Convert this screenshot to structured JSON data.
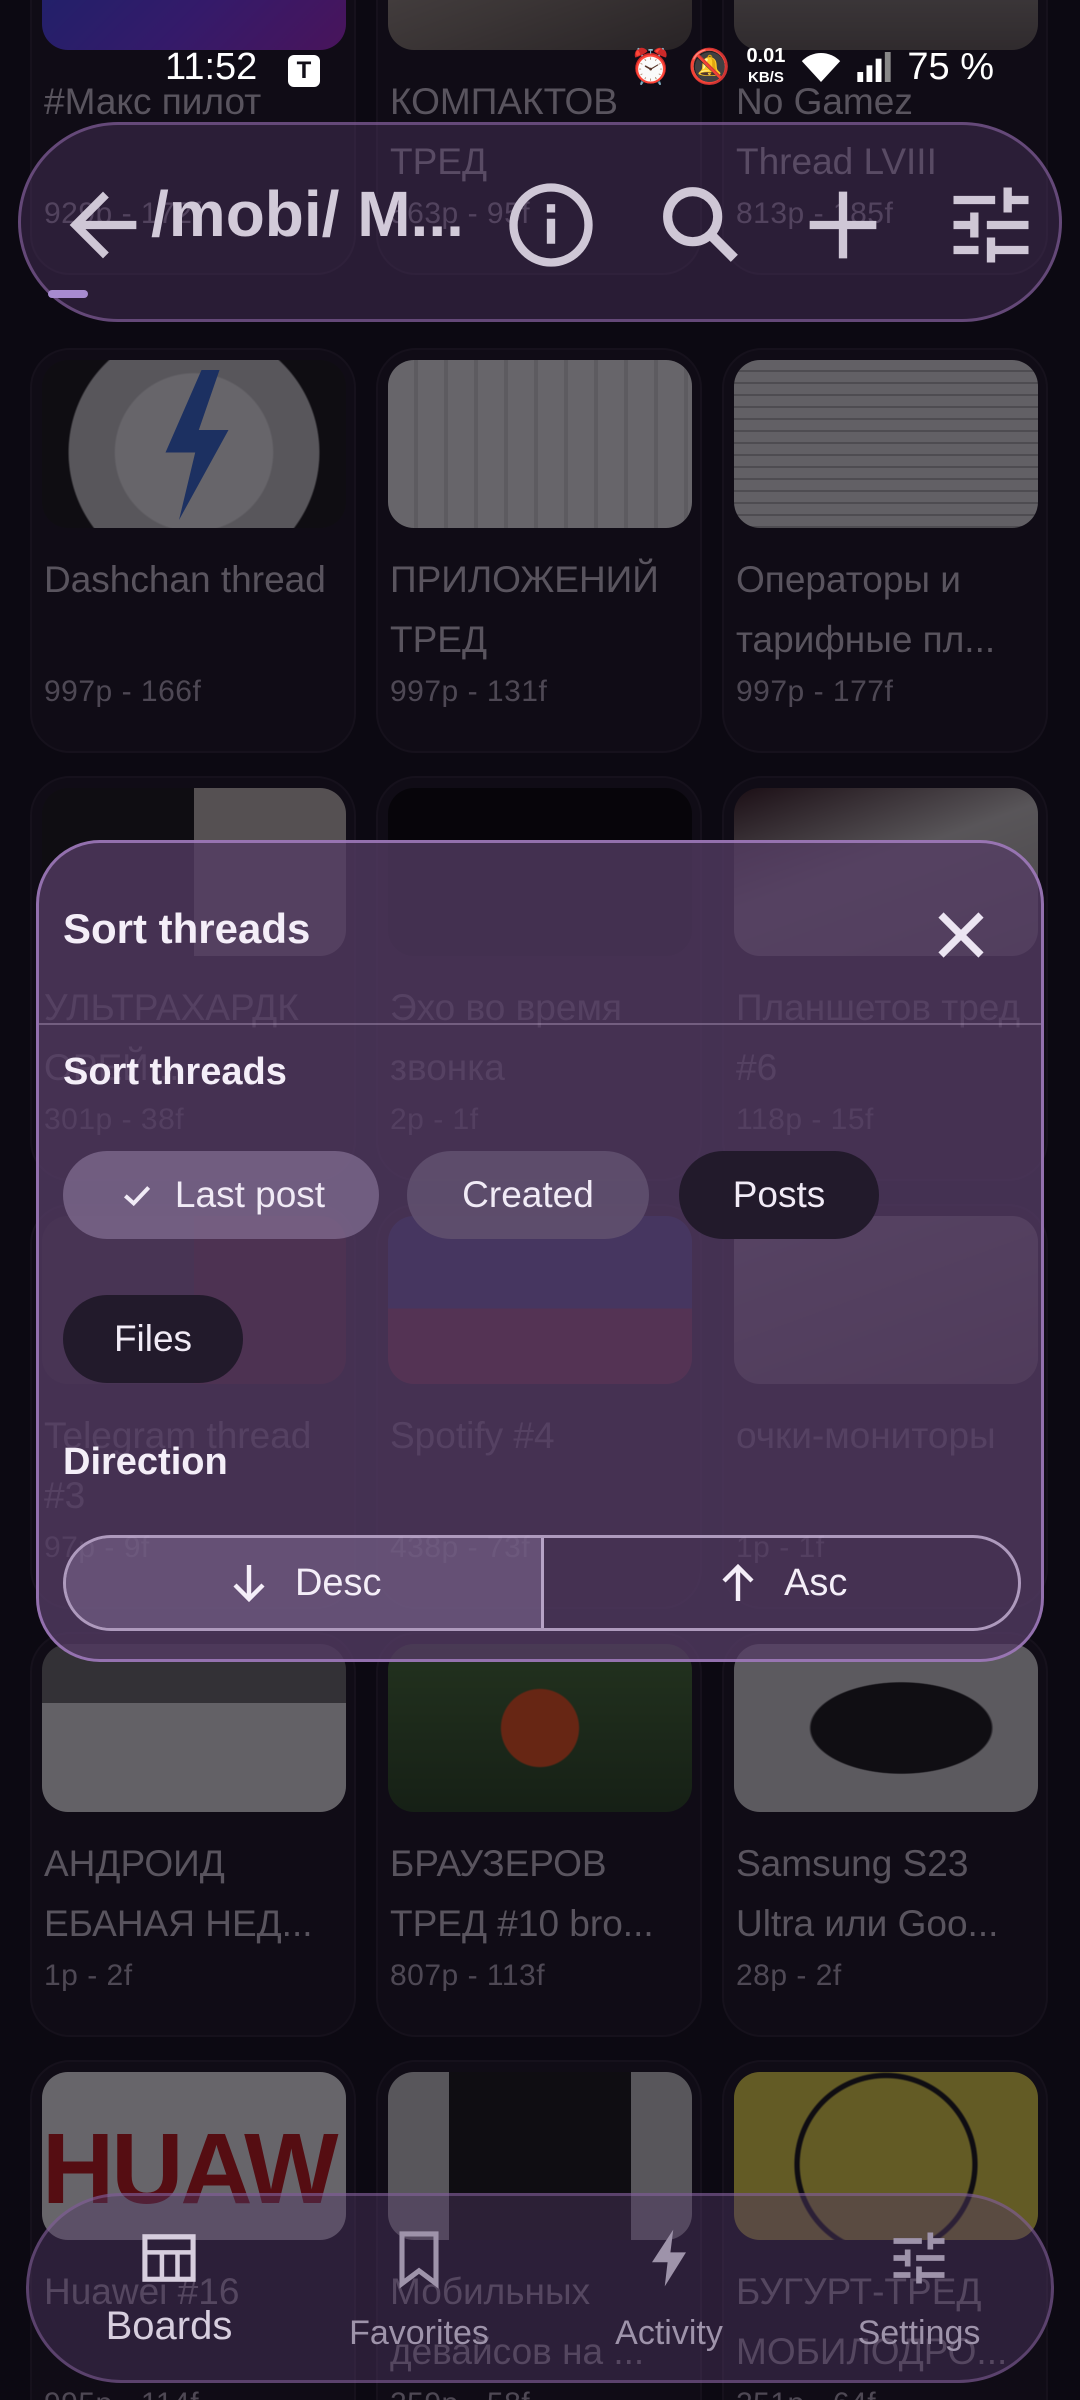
{
  "status_bar": {
    "time": "11:52",
    "app_badge": "T",
    "net_speed_value": "0.01",
    "net_speed_unit": "KB/S",
    "battery": "75 %"
  },
  "app_bar": {
    "title": "/mobi/ М...",
    "back_icon": "arrow-back-icon",
    "info_icon": "info-icon",
    "search_icon": "search-icon",
    "add_icon": "add-icon",
    "filter_icon": "tune-icon"
  },
  "threads": [
    {
      "title": "#Макс пилот",
      "stats": "929p - 172f",
      "thumb": "max"
    },
    {
      "title": "КОМПАКТОВ ТРЕД",
      "stats": "563p - 95f",
      "thumb": "hands"
    },
    {
      "title": "No Gamez Thread LVIII",
      "stats": "813p - 185f",
      "thumb": "nogamez"
    },
    {
      "title": "Dashchan thread",
      "stats": "997p - 166f",
      "thumb": "dash"
    },
    {
      "title": "ПРИЛОЖЕНИЙ ТРЕД",
      "stats": "997p - 131f",
      "thumb": "apps"
    },
    {
      "title": "Операторы и тарифные пл...",
      "stats": "997p - 177f",
      "thumb": "oper"
    },
    {
      "title": "УЛЬТРАХАРДК ОРЕЙ...",
      "stats": "301p - 38f",
      "thumb": "ultra"
    },
    {
      "title": "Эхо во время звонка",
      "stats": "2p - 1f",
      "thumb": "black"
    },
    {
      "title": "Планшетов тред #6",
      "stats": "118p - 15f",
      "thumb": "legion"
    },
    {
      "title": "Telegram thread #3",
      "stats": "97p - 9f",
      "thumb": "telegram"
    },
    {
      "title": "Spotify #4",
      "stats": "438p - 73f",
      "thumb": "spotify"
    },
    {
      "title": "очки-мониторы",
      "stats": "1p - 1f",
      "thumb": "glasses"
    },
    {
      "title": "АНДРОИД ЕБАНАЯ НЕД...",
      "stats": "1p - 2f",
      "thumb": "snow"
    },
    {
      "title": "БРАУЗЕРОВ ТРЕД #10 bro...",
      "stats": "807p - 113f",
      "thumb": "brave"
    },
    {
      "title": "Samsung S23 Ultra или Goo...",
      "stats": "28p - 2f",
      "thumb": "s23"
    },
    {
      "title": "Huawei #16",
      "stats": "995p - 114f",
      "thumb": "huawei"
    },
    {
      "title": "Мобильных девайсов на ...",
      "stats": "259p - 58f",
      "thumb": "phone2"
    },
    {
      "title": "БУГУРТ-ТРЕД МОБИЛОДРО...",
      "stats": "251p - 64f",
      "thumb": "troll"
    }
  ],
  "dialog": {
    "title": "Sort threads",
    "close_icon": "close-icon",
    "sort_label": "Sort threads",
    "sort_options": [
      "Last post",
      "Created",
      "Posts",
      "Files"
    ],
    "sort_selected": "Last post",
    "direction_label": "Direction",
    "direction_options": [
      "Desc",
      "Asc"
    ],
    "direction_selected": "Desc"
  },
  "bottom_nav": {
    "items": [
      {
        "label": "Boards",
        "icon": "boards-icon",
        "active": true
      },
      {
        "label": "Favorites",
        "icon": "bookmark-icon",
        "active": false
      },
      {
        "label": "Activity",
        "icon": "bolt-icon",
        "active": false
      },
      {
        "label": "Settings",
        "icon": "tune-icon",
        "active": false
      }
    ]
  },
  "colors": {
    "background": "#120f18",
    "dialog": "#54406a",
    "accent": "#a78bd0"
  }
}
